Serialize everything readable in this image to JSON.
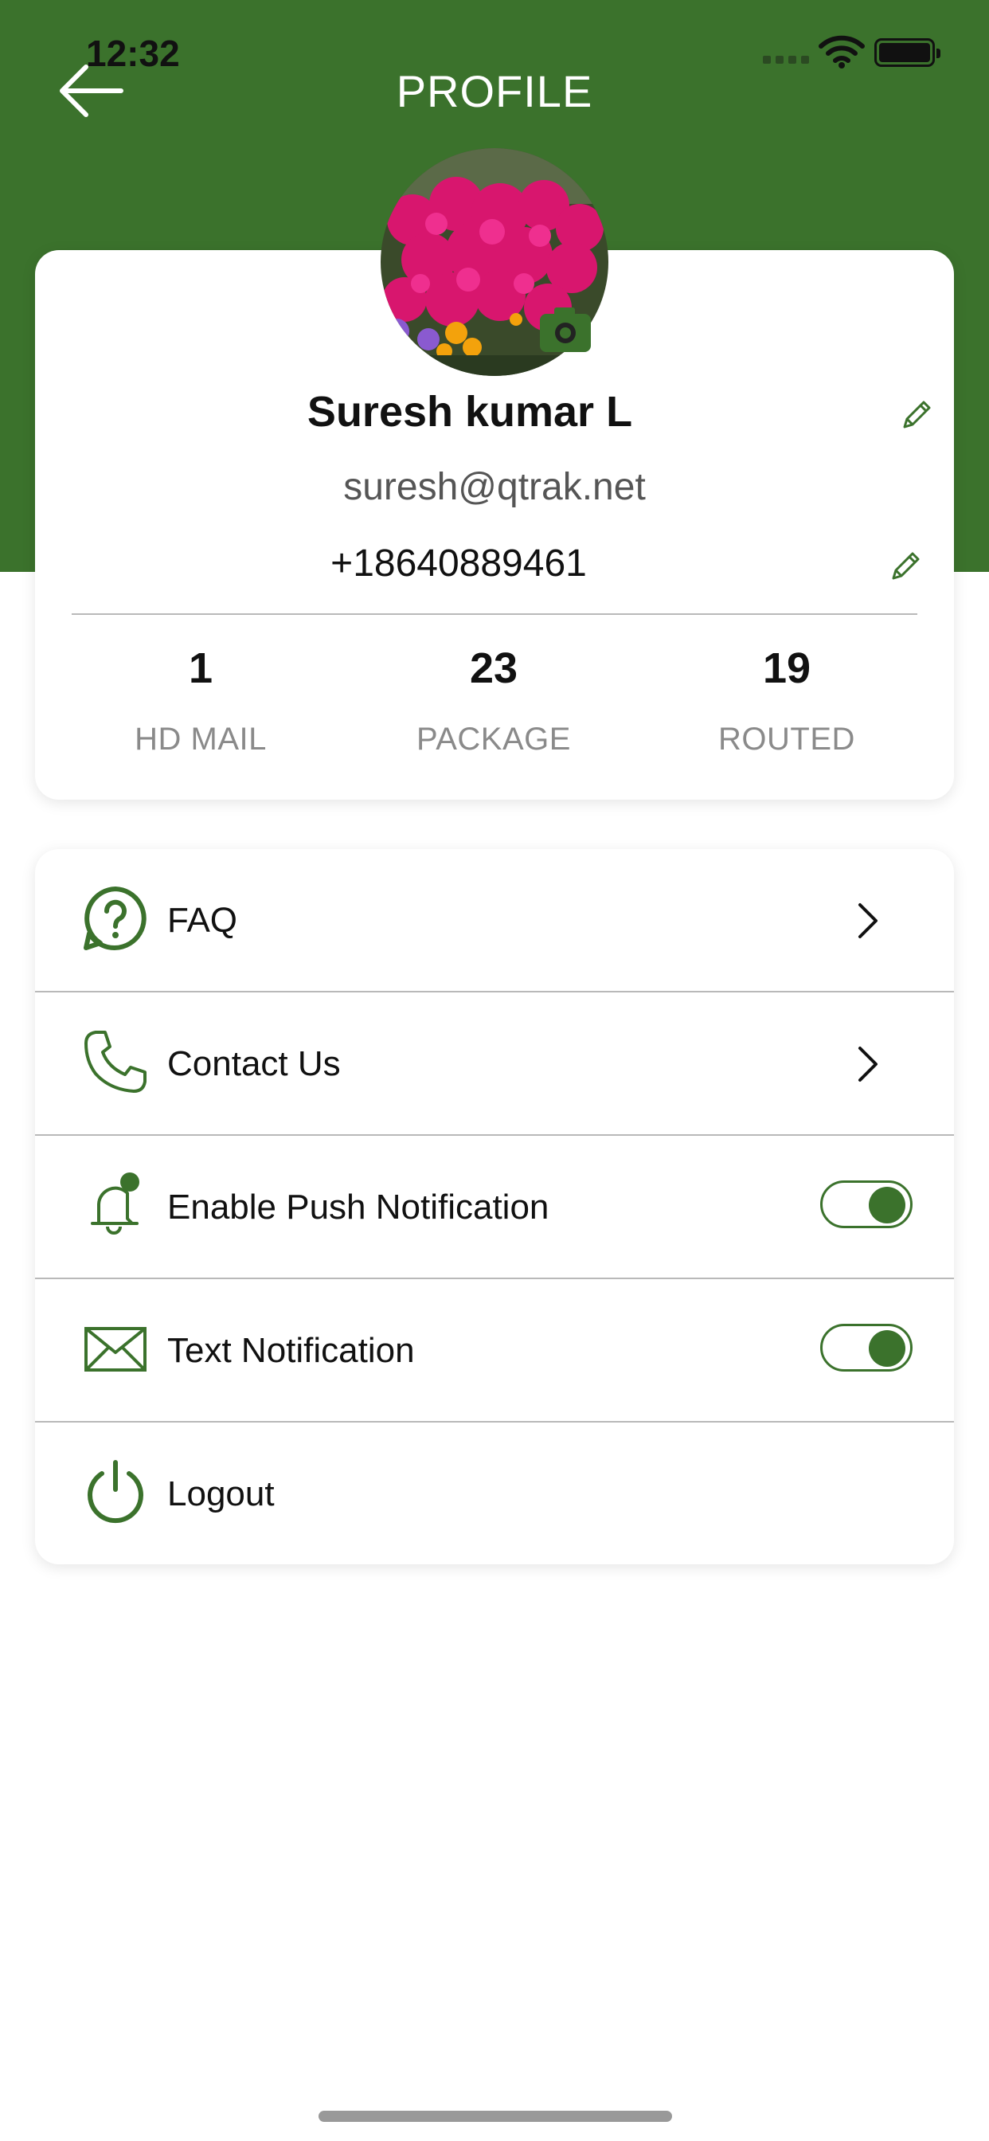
{
  "status_bar": {
    "time": "12:32"
  },
  "header": {
    "title": "PROFILE",
    "back_icon": "arrow-left-icon"
  },
  "profile": {
    "name": "Suresh kumar L",
    "email": "suresh@qtrak.net",
    "phone": "+18640889461",
    "avatar_icon": "flower-photo",
    "camera_icon": "camera-icon",
    "edit_icon": "pencil-icon"
  },
  "stats": [
    {
      "value": "1",
      "label": "HD MAIL"
    },
    {
      "value": "23",
      "label": "PACKAGE"
    },
    {
      "value": "19",
      "label": "ROUTED"
    }
  ],
  "menu": {
    "items": [
      {
        "label": "FAQ",
        "icon": "question-bubble-icon",
        "control": "chevron"
      },
      {
        "label": "Contact Us",
        "icon": "phone-icon",
        "control": "chevron"
      },
      {
        "label": "Enable Push Notification",
        "icon": "bell-icon",
        "control": "toggle",
        "toggle_on": true
      },
      {
        "label": "Text Notification",
        "icon": "envelope-icon",
        "control": "toggle",
        "toggle_on": true
      },
      {
        "label": "Logout",
        "icon": "power-icon",
        "control": "none"
      }
    ]
  },
  "colors": {
    "accent": "#3b722c",
    "divider": "#b9b9b9",
    "muted_text": "#8a8a8a"
  }
}
